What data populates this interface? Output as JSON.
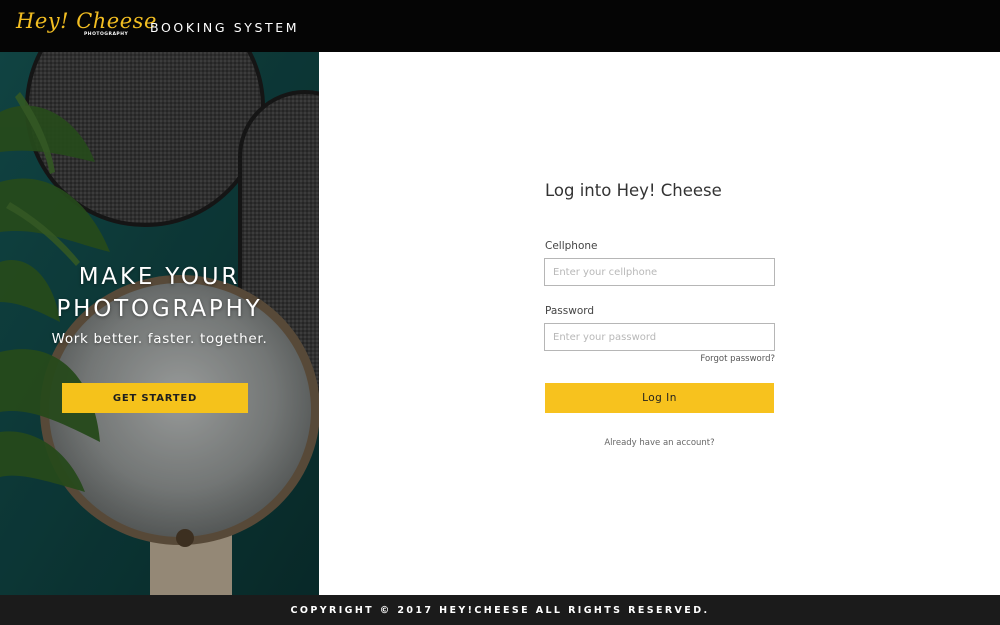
{
  "header": {
    "logo_text": "Hey! Cheese",
    "logo_subtext": "PHOTOGRAPHY",
    "title": "BOOKING SYSTEM"
  },
  "hero": {
    "headline_line1": "MAKE YOUR",
    "headline_line2": "PHOTOGRAPHY",
    "tagline": "Work better. faster. together.",
    "cta_label": "GET STARTED"
  },
  "login": {
    "heading": "Log into Hey! Cheese",
    "cellphone_label": "Cellphone",
    "cellphone_placeholder": "Enter your cellphone",
    "password_label": "Password",
    "password_placeholder": "Enter your password",
    "forgot_label": "Forgot password?",
    "submit_label": "Log In",
    "account_link": "Already have an account?"
  },
  "footer": {
    "copyright": "COPYRIGHT © 2017 HEY!CHEESE ALL RIGHTS RESERVED."
  },
  "colors": {
    "accent": "#f5c21b",
    "header_bg": "#050505",
    "footer_bg": "#1b1b1b",
    "hero_bg": "#0f3c3a"
  }
}
